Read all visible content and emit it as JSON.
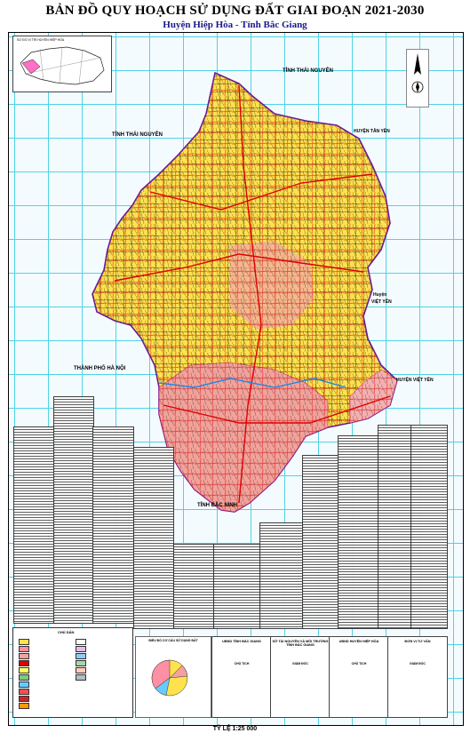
{
  "map": {
    "title": "BẢN ĐỒ QUY HOẠCH SỬ DỤNG ĐẤT GIAI ĐOẠN 2021-2030",
    "subtitle": "Huyện Hiệp Hòa - Tỉnh Bắc Giang",
    "scale": "TỶ LỆ 1:25 000",
    "inset_caption": "SƠ ĐỒ VỊ TRÍ HUYỆN HIỆP HÒA",
    "place_labels": {
      "thai_nguyen_ne": "TỈNH THÁI NGUYÊN",
      "thai_nguyen_w": "TỈNH THÁI NGUYÊN",
      "tan_yen": "HUYỆN TÂN YÊN",
      "viet_yen_1": "Huyện",
      "viet_yen_2": "VIỆT YÊN",
      "viet_yen_3": "HUYỆN VIỆT YÊN",
      "ha_noi": "THÀNH PHỐ HÀ NỘI",
      "bac_ninh": "TỈNH BẮC NINH"
    },
    "legend_caption": "CHÚ DẪN",
    "pie_caption": "BIỂU ĐỒ CƠ CẤU SỬ DỤNG ĐẤT",
    "signatures": [
      {
        "org": "UBND TỈNH BẮC GIANG",
        "role": "CHỦ TỊCH"
      },
      {
        "org": "SỞ TÀI NGUYÊN VÀ MÔI TRƯỜNG TỈNH BẮC GIANG",
        "role": "GIÁM ĐỐC"
      },
      {
        "org": "UBND HUYỆN HIỆP HÒA",
        "role": "CHỦ TỊCH"
      },
      {
        "org": "ĐƠN VỊ TƯ VẤN",
        "role": "GIÁM ĐỐC"
      }
    ],
    "colors": {
      "agri": "#ffe24d",
      "residential": "#ff8fa3",
      "urban": "#f2a0a0",
      "roads": "#e00000",
      "rice": "#ffff66",
      "forest": "#7fc97f",
      "water": "#66ccff",
      "grid": "#4fd3e6",
      "boundary": "#6a1b9a"
    }
  }
}
